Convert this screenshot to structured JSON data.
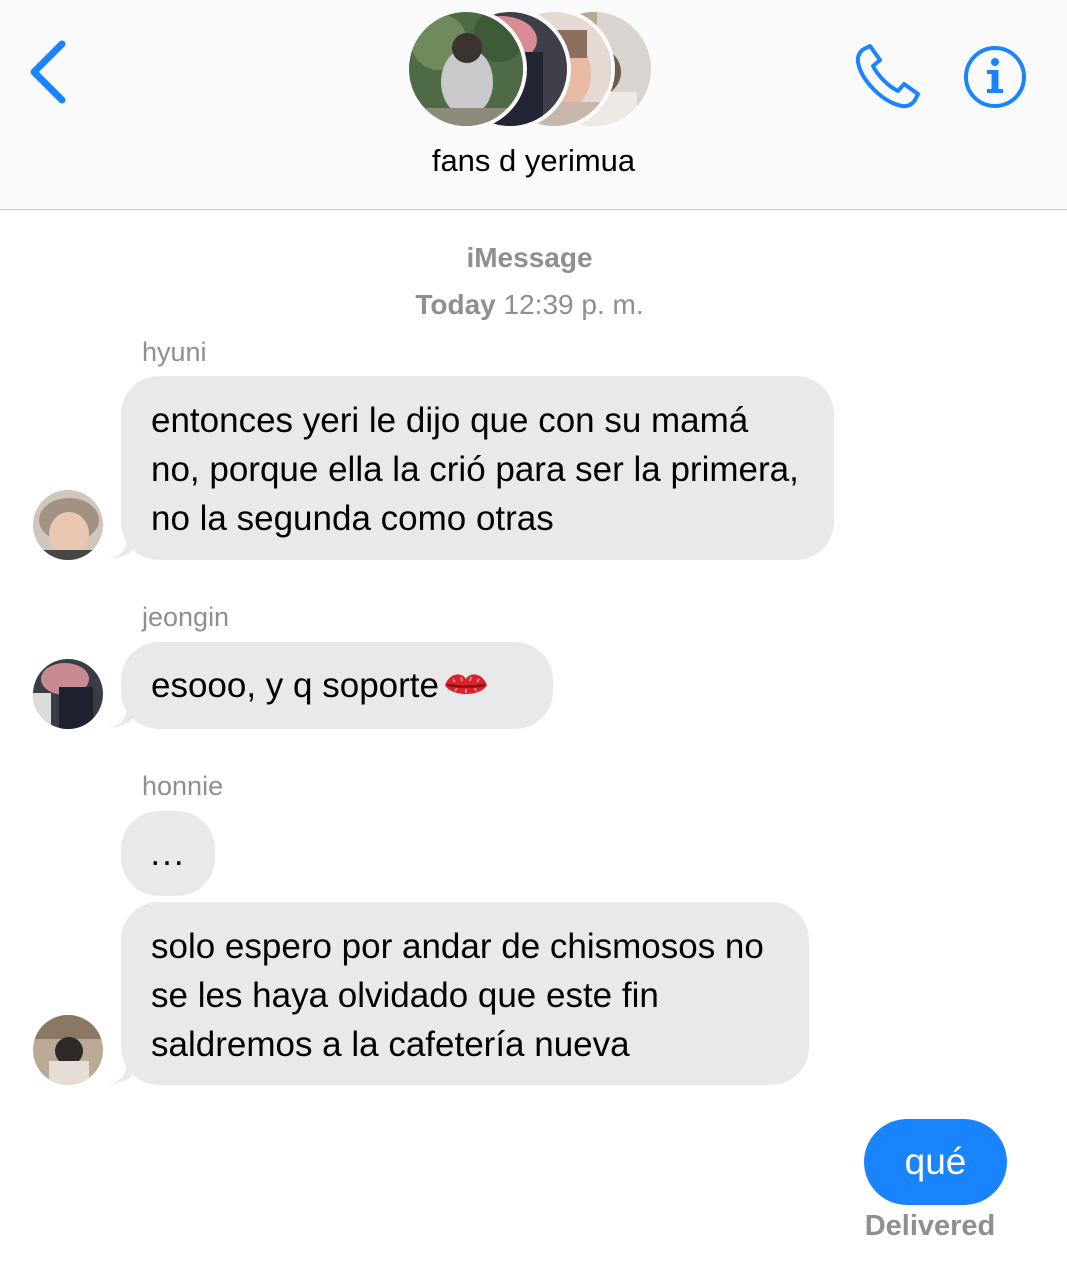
{
  "header": {
    "title": "fans d yerimua",
    "back_icon": "chevron-left-icon",
    "call_icon": "phone-icon",
    "info_icon": "info-icon",
    "accent_color": "#1a84ff"
  },
  "thread": {
    "service": "iMessage",
    "day": "Today",
    "time": "12:39 p. m."
  },
  "messages": [
    {
      "sender": "hyuni",
      "bubbles": [
        "entonces yeri le dijo que con su mamá no, porque ella la crió para ser la primera, no la segunda como otras"
      ]
    },
    {
      "sender": "jeongin",
      "bubbles": [
        "esooo, y q soporte"
      ],
      "emoji": "💋"
    },
    {
      "sender": "honnie",
      "bubbles": [
        "...",
        "solo espero por andar de chismosos no se les haya olvidado que este fin saldremos a la cafetería nueva"
      ]
    }
  ],
  "outgoing": {
    "text": "qué",
    "status": "Delivered",
    "bubble_color": "#1a84ff"
  },
  "colors": {
    "incoming_bubble": "#e9e9eb",
    "secondary_text": "#8e8e93"
  }
}
